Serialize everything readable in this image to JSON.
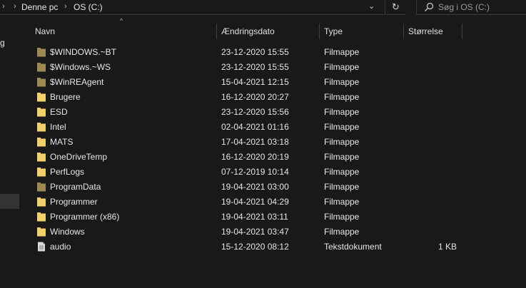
{
  "address_bar": {
    "crumbs": [
      "Denne pc",
      "OS (C:)"
    ]
  },
  "search": {
    "placeholder": "Søg i OS (C:)"
  },
  "nav_pane": {
    "visible_fragment": "g"
  },
  "columns": {
    "name": "Navn",
    "date": "Ændringsdato",
    "type": "Type",
    "size": "Størrelse"
  },
  "colors": {
    "background": "#191919",
    "folder": "#f3d16a",
    "folder_hidden": "#9c8a55",
    "file": "#d8d8d8"
  },
  "rows": [
    {
      "name": "$WINDOWS.~BT",
      "date": "23-12-2020 15:55",
      "type": "Filmappe",
      "size": "",
      "icon": "folder-hidden-icon"
    },
    {
      "name": "$Windows.~WS",
      "date": "23-12-2020 15:55",
      "type": "Filmappe",
      "size": "",
      "icon": "folder-hidden-icon"
    },
    {
      "name": "$WinREAgent",
      "date": "15-04-2021 12:15",
      "type": "Filmappe",
      "size": "",
      "icon": "folder-hidden-icon"
    },
    {
      "name": "Brugere",
      "date": "16-12-2020 20:27",
      "type": "Filmappe",
      "size": "",
      "icon": "folder-icon"
    },
    {
      "name": "ESD",
      "date": "23-12-2020 15:56",
      "type": "Filmappe",
      "size": "",
      "icon": "folder-icon"
    },
    {
      "name": "Intel",
      "date": "02-04-2021 01:16",
      "type": "Filmappe",
      "size": "",
      "icon": "folder-icon"
    },
    {
      "name": "MATS",
      "date": "17-04-2021 03:18",
      "type": "Filmappe",
      "size": "",
      "icon": "folder-icon"
    },
    {
      "name": "OneDriveTemp",
      "date": "16-12-2020 20:19",
      "type": "Filmappe",
      "size": "",
      "icon": "folder-icon"
    },
    {
      "name": "PerfLogs",
      "date": "07-12-2019 10:14",
      "type": "Filmappe",
      "size": "",
      "icon": "folder-icon"
    },
    {
      "name": "ProgramData",
      "date": "19-04-2021 03:00",
      "type": "Filmappe",
      "size": "",
      "icon": "folder-hidden-icon"
    },
    {
      "name": "Programmer",
      "date": "19-04-2021 04:29",
      "type": "Filmappe",
      "size": "",
      "icon": "folder-icon"
    },
    {
      "name": "Programmer (x86)",
      "date": "19-04-2021 03:11",
      "type": "Filmappe",
      "size": "",
      "icon": "folder-icon"
    },
    {
      "name": "Windows",
      "date": "19-04-2021 03:47",
      "type": "Filmappe",
      "size": "",
      "icon": "folder-icon"
    },
    {
      "name": "audio",
      "date": "15-12-2020 08:12",
      "type": "Tekstdokument",
      "size": "1 KB",
      "icon": "text-file-icon"
    }
  ]
}
